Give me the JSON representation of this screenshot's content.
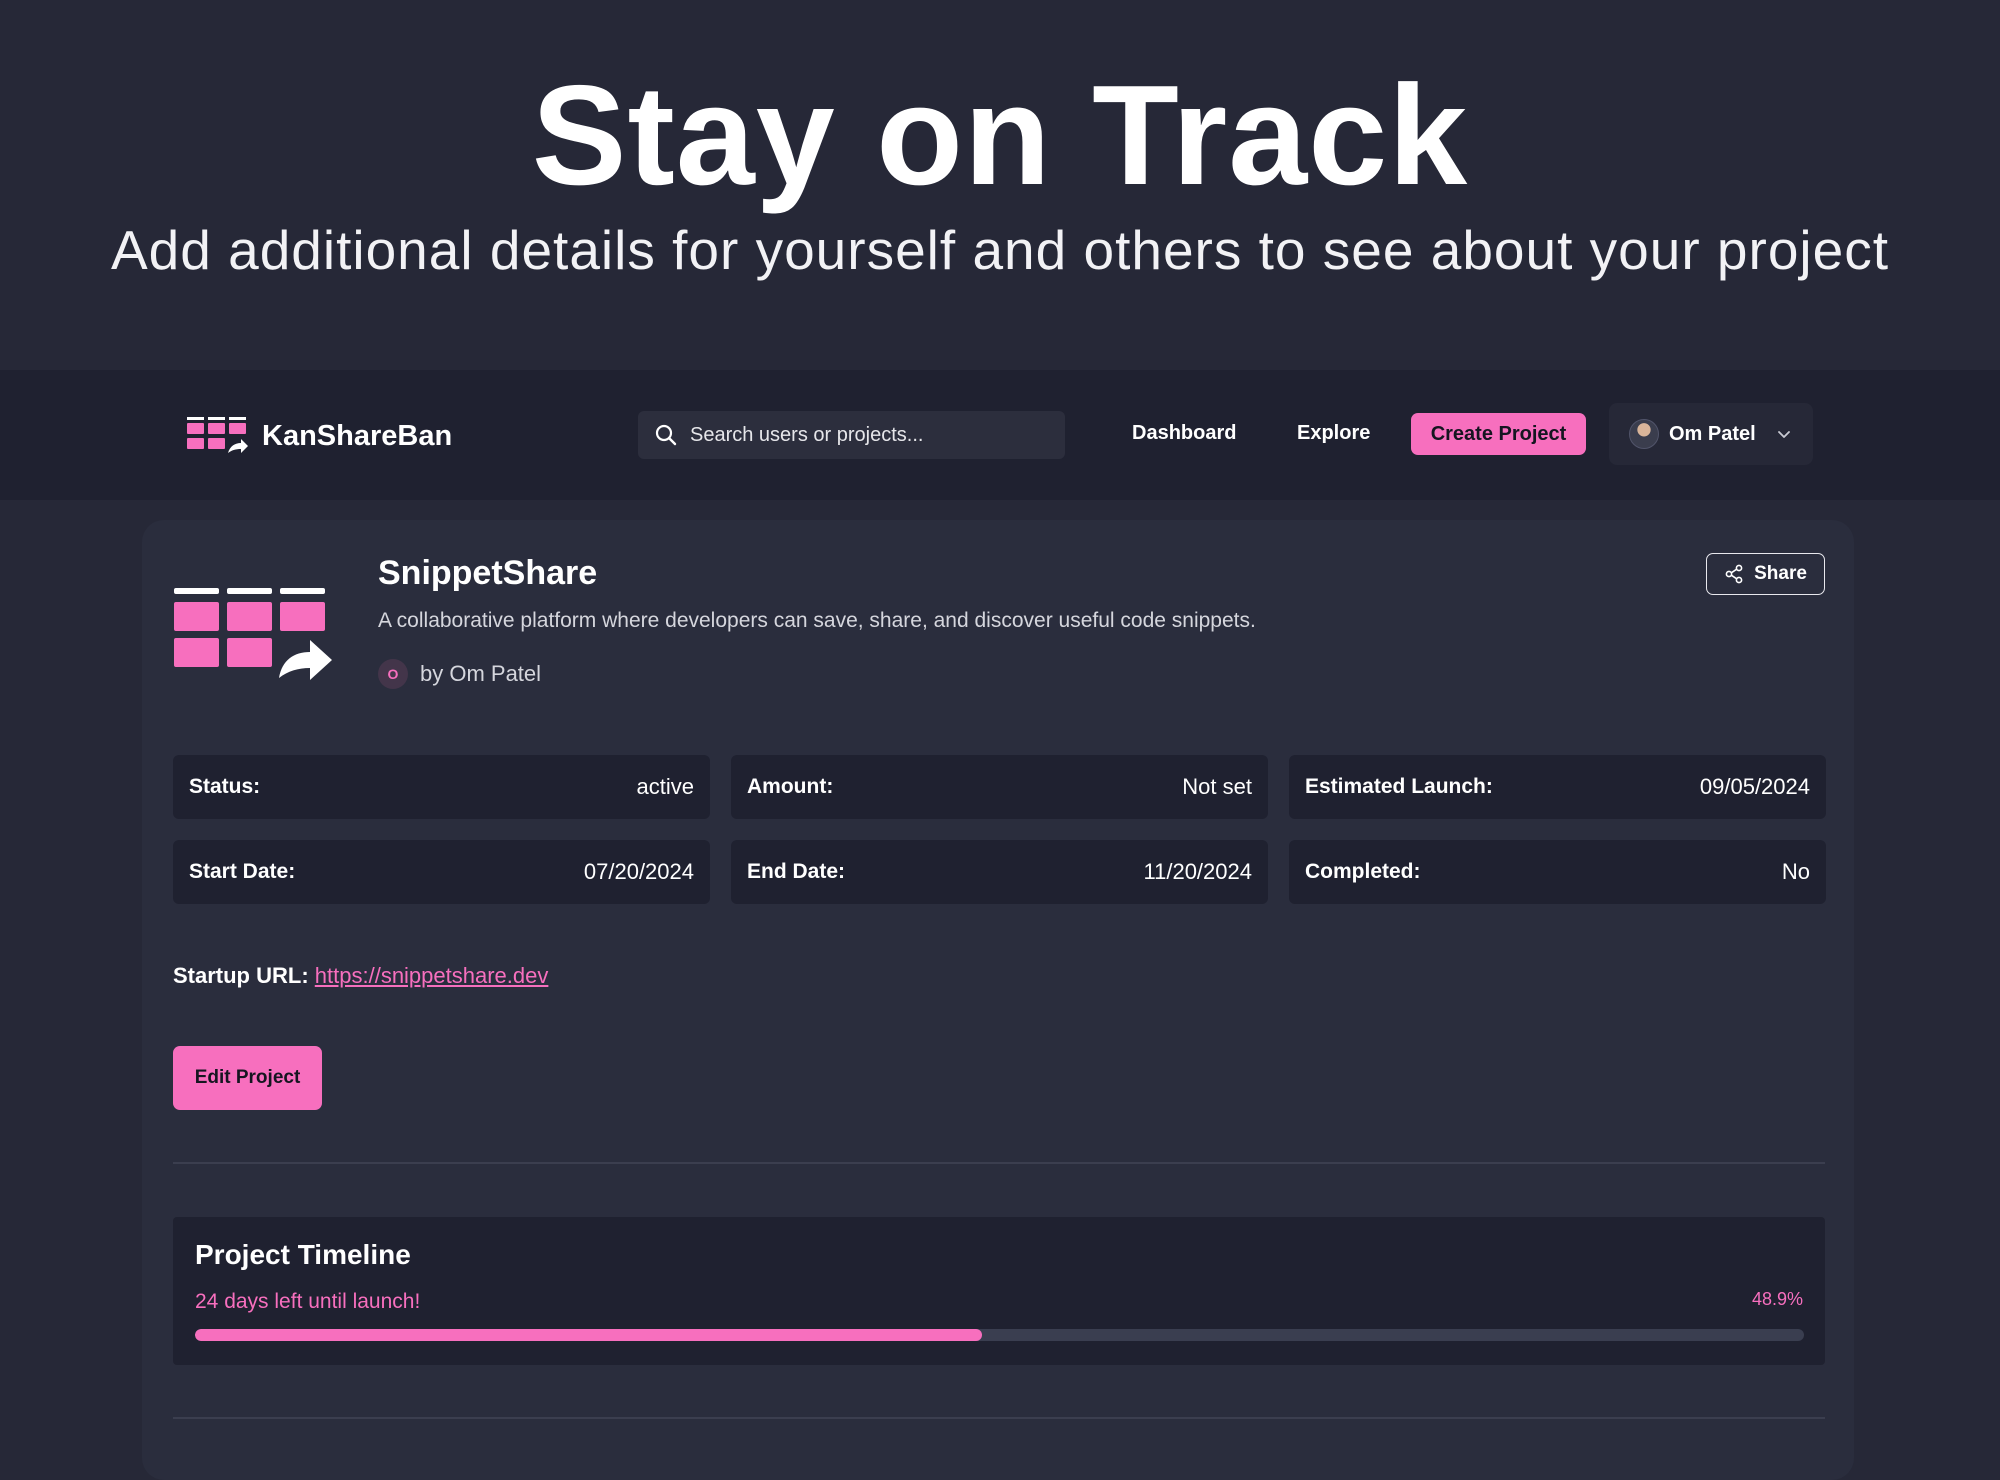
{
  "hero": {
    "title": "Stay on Track",
    "subtitle": "Add additional details for yourself and others to see about your project"
  },
  "navbar": {
    "brand": "KanShareBan",
    "search_placeholder": "Search users or projects...",
    "links": [
      "Dashboard",
      "Explore"
    ],
    "create_label": "Create Project",
    "user_name": "Om Patel"
  },
  "project": {
    "title": "SnippetShare",
    "description": "A collaborative platform where developers can save, share, and discover useful code snippets.",
    "owner_initial": "O",
    "owner_text": "by Om Patel",
    "share_label": "Share",
    "stats": [
      {
        "label": "Status:",
        "value": "active"
      },
      {
        "label": "Amount:",
        "value": "Not set"
      },
      {
        "label": "Estimated Launch:",
        "value": "09/05/2024"
      },
      {
        "label": "Start Date:",
        "value": "07/20/2024"
      },
      {
        "label": "End Date:",
        "value": "11/20/2024"
      },
      {
        "label": "Completed:",
        "value": "No"
      }
    ],
    "url_label": "Startup URL:",
    "url": "https://snippetshare.dev",
    "edit_label": "Edit Project"
  },
  "timeline": {
    "title": "Project Timeline",
    "days_left": "24 days left until launch!",
    "percent_label": "48.9%",
    "progress": 48.9
  },
  "colors": {
    "accent": "#f76fbe",
    "background": "#262837",
    "navbar": "#1f2130",
    "card": "#2a2d3d"
  }
}
